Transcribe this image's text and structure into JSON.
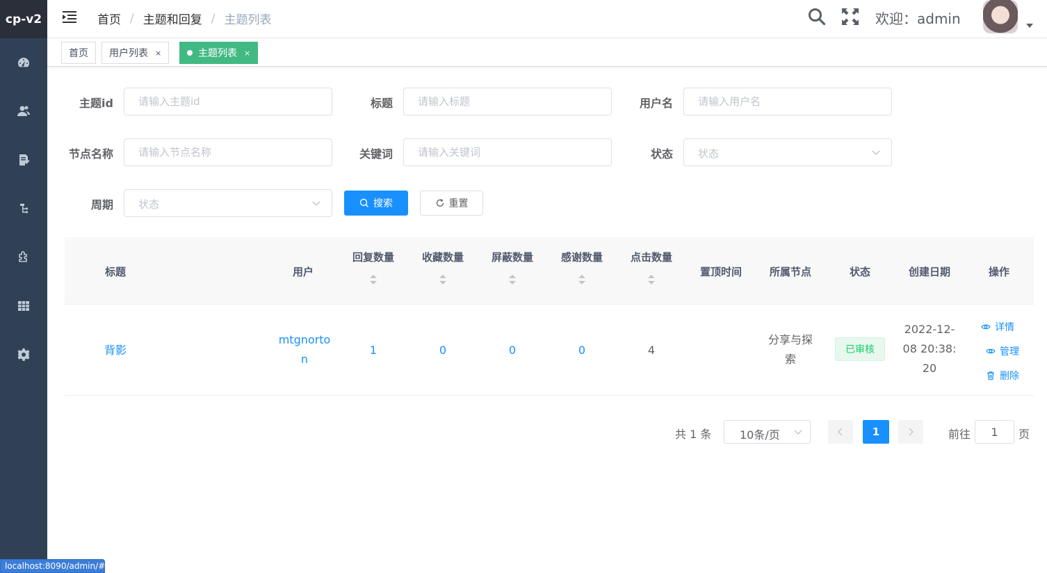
{
  "app": {
    "logo": "cp-v2"
  },
  "sidebar": {
    "icons": [
      "dashboard-icon",
      "users-icon",
      "topics-icon",
      "nodes-icon",
      "plugin-icon",
      "table-icon",
      "settings-icon"
    ]
  },
  "header": {
    "breadcrumb": [
      "首页",
      "主题和回复",
      "主题列表"
    ],
    "welcome": "欢迎：admin"
  },
  "tags": [
    {
      "label": "首页",
      "closable": false,
      "active": false
    },
    {
      "label": "用户列表",
      "closable": true,
      "active": false
    },
    {
      "label": "主题列表",
      "closable": true,
      "active": true
    }
  ],
  "filters": {
    "topic_id": {
      "label": "主题id",
      "placeholder": "请输入主题id"
    },
    "title": {
      "label": "标题",
      "placeholder": "请输入标题"
    },
    "username": {
      "label": "用户名",
      "placeholder": "请输入用户名"
    },
    "node_name": {
      "label": "节点名称",
      "placeholder": "请输入节点名称"
    },
    "keyword": {
      "label": "关键词",
      "placeholder": "请输入关键词"
    },
    "status": {
      "label": "状态",
      "placeholder": "状态"
    },
    "period": {
      "label": "周期",
      "placeholder": "状态"
    },
    "search_label": "搜索",
    "reset_label": "重置"
  },
  "table": {
    "columns": [
      "标题",
      "用户",
      "回复数量",
      "收藏数量",
      "屏蔽数量",
      "感谢数量",
      "点击数量",
      "置顶时间",
      "所属节点",
      "状态",
      "创建日期",
      "操作"
    ],
    "rows": [
      {
        "title": "背影",
        "user_line1": "mtgnorto",
        "user_line2": "n",
        "replies": "1",
        "favorites": "0",
        "blocks": "0",
        "thanks": "0",
        "clicks": "4",
        "pinned_time": "",
        "node_line1": "分享与探",
        "node_line2": "索",
        "status": "已审核",
        "created_line1": "2022-12-",
        "created_line2": "08 20:38:",
        "created_line3": "20",
        "ops": {
          "detail": "详情",
          "manage": "管理",
          "delete": "删除"
        }
      }
    ]
  },
  "pagination": {
    "total": "共 1 条",
    "page_size": "10条/页",
    "current_page": "1",
    "goto_prefix": "前往",
    "goto_value": "1",
    "goto_suffix": "页"
  },
  "statusbar": {
    "url": "localhost:8090/admin/#/"
  },
  "colors": {
    "primary": "#1890ff",
    "sidebar": "#304156",
    "tag_active": "#42b983",
    "success": "#13ce66"
  }
}
